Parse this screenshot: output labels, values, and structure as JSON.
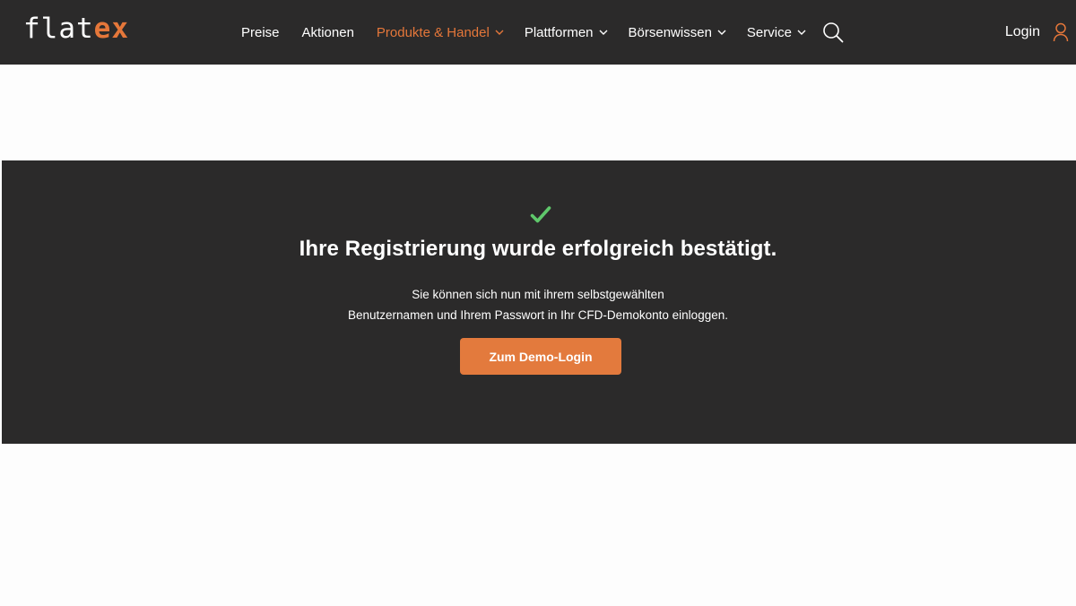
{
  "header": {
    "logo": {
      "part1": "flat",
      "part2": "ex"
    },
    "nav": [
      {
        "label": "Preise",
        "has_dropdown": false,
        "active": false
      },
      {
        "label": "Aktionen",
        "has_dropdown": false,
        "active": false
      },
      {
        "label": "Produkte & Handel",
        "has_dropdown": true,
        "active": true
      },
      {
        "label": "Plattformen",
        "has_dropdown": true,
        "active": false
      },
      {
        "label": "Börsenwissen",
        "has_dropdown": true,
        "active": false
      },
      {
        "label": "Service",
        "has_dropdown": true,
        "active": false
      }
    ],
    "search_icon": "search-icon",
    "login_label": "Login",
    "login_icon": "user-icon"
  },
  "confirmation": {
    "icon": "check-icon",
    "title": "Ihre Registrierung wurde erfolgreich bestätigt.",
    "description_line1": "Sie können sich nun mit ihrem selbstgewählten",
    "description_line2": "Benutzernamen und Ihrem Passwort in Ihr CFD-Demokonto einloggen.",
    "button_label": "Zum Demo-Login"
  },
  "colors": {
    "header_bg": "#2b2a2a",
    "accent": "#e5773a",
    "success": "#5fc86b",
    "page_bg": "#fdfdfd"
  }
}
